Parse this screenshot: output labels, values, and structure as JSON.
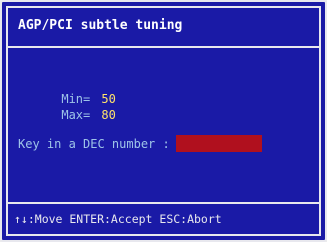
{
  "dialog": {
    "title": "AGP/PCI subtle tuning",
    "min_label": "Min=",
    "min_value": "50",
    "max_label": "Max=",
    "max_value": "80",
    "prompt": "Key in a DEC number :",
    "input_value": "",
    "footer": "↑↓:Move ENTER:Accept ESC:Abort"
  },
  "colors": {
    "background": "#1a1aa6",
    "border": "#e8e8ee",
    "label": "#9ec4e8",
    "value": "#ffe36b",
    "input": "#b0101e"
  }
}
